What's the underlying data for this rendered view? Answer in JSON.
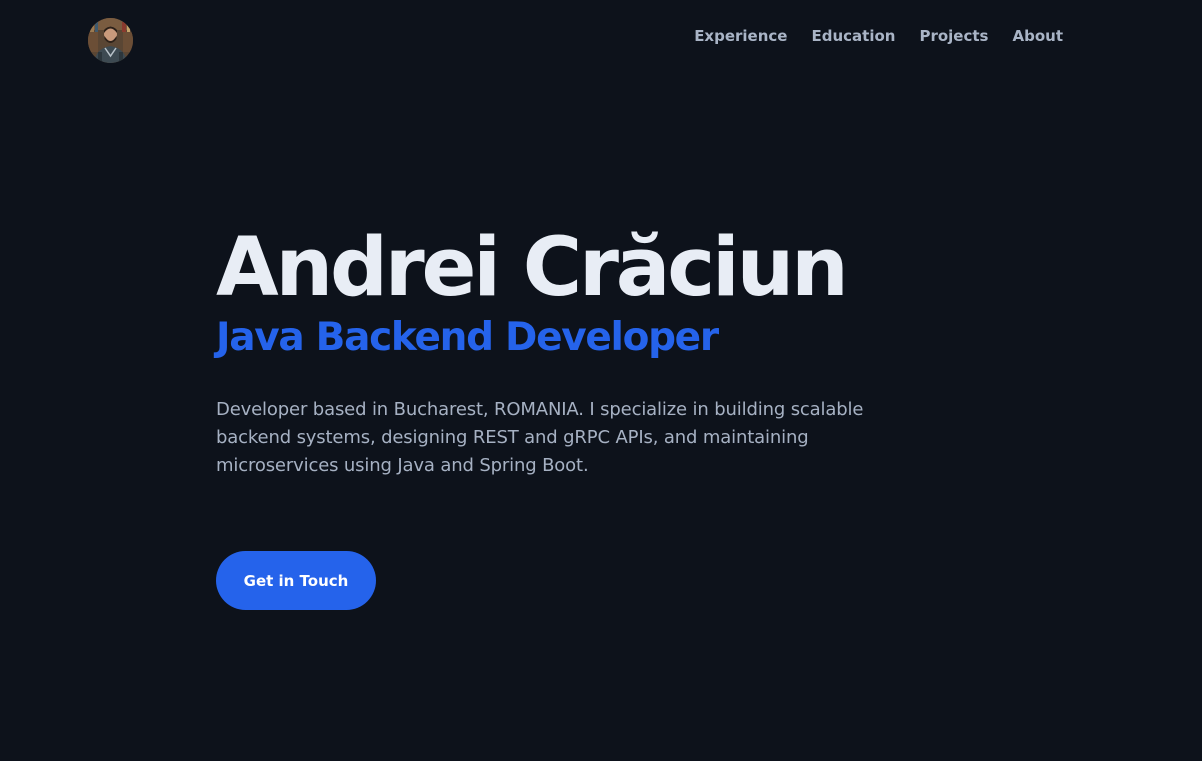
{
  "header": {
    "avatar_icon": "profile-photo",
    "nav": [
      {
        "label": "Experience"
      },
      {
        "label": "Education"
      },
      {
        "label": "Projects"
      },
      {
        "label": "About"
      }
    ]
  },
  "hero": {
    "name": "Andrei Crăciun",
    "role": "Java Backend Developer",
    "description": "Developer based in Bucharest, ROMANIA. I specialize in building scalable backend systems, designing REST and gRPC APIs, and maintaining microservices using Java and Spring Boot.",
    "cta_label": "Get in Touch"
  },
  "colors": {
    "background": "#0d121b",
    "accent": "#2563eb",
    "heading": "#e8edf5",
    "muted_text": "#a6b1c3"
  }
}
